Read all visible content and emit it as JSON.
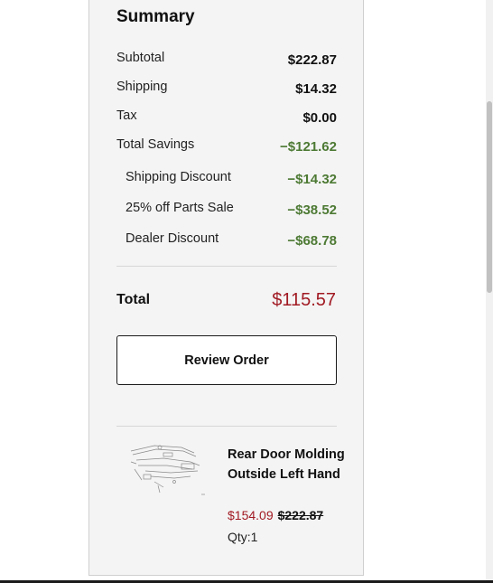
{
  "summary": {
    "title": "Summary",
    "subtotal": {
      "label": "Subtotal",
      "value": "$222.87"
    },
    "shipping": {
      "label": "Shipping",
      "value": "$14.32"
    },
    "tax": {
      "label": "Tax",
      "value": "$0.00"
    },
    "total_savings": {
      "label": "Total Savings",
      "value": "−$121.62"
    },
    "shipping_discount": {
      "label": "Shipping Discount",
      "value": "−$14.32"
    },
    "parts_sale": {
      "label": "25% off Parts Sale",
      "value": "−$38.52"
    },
    "dealer_discount": {
      "label": "Dealer Discount",
      "value": "−$68.78"
    },
    "total": {
      "label": "Total",
      "value": "$115.57"
    },
    "review_button": "Review Order"
  },
  "item": {
    "image_icon": "part-diagram-thumbnail",
    "name": "Rear Door Molding Outside Left Hand",
    "sale_price": "$154.09",
    "original_price": "$222.87",
    "qty": "Qty:1"
  },
  "colors": {
    "savings": "#4d7a34",
    "price_red": "#a11a23",
    "panel_bg": "#f4f4f4"
  }
}
